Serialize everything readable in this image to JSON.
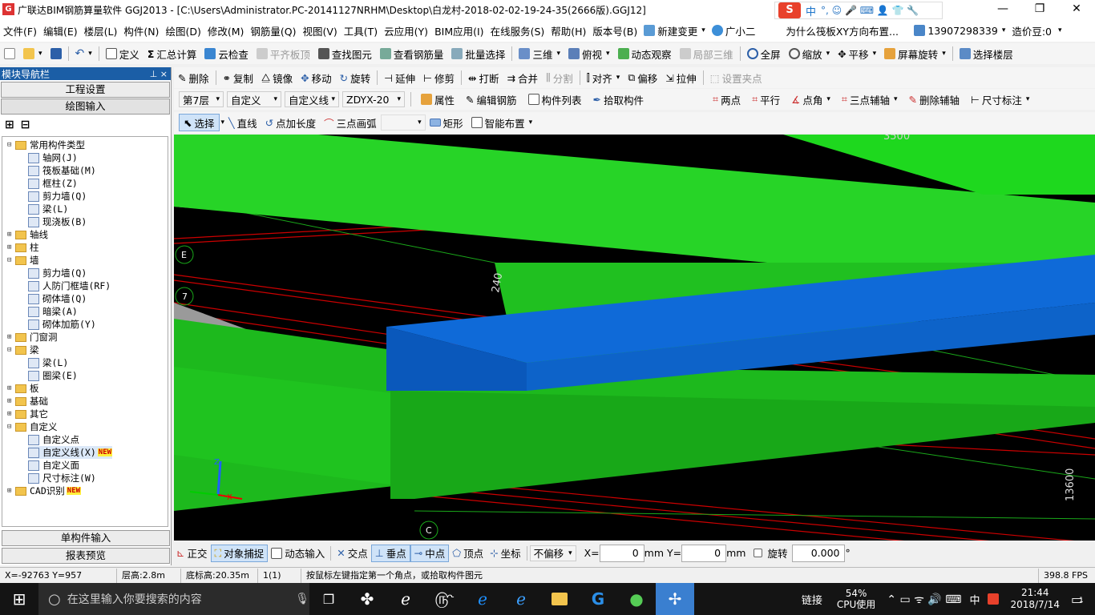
{
  "title": {
    "text": "广联达BIM钢筋算量软件 GGJ2013 - [C:\\Users\\Administrator.PC-20141127NRHM\\Desktop\\白龙村-2018-02-02-19-24-35(2666版).GGJ12]",
    "minimize": "—",
    "restore": "❐",
    "close": "✕"
  },
  "ime": {
    "logo": "S",
    "lang": "中",
    "glyphs": "°, ☺ 🎤 ⌨ 👤 👕 🔧"
  },
  "menu": [
    "文件(F)",
    "编辑(E)",
    "楼层(L)",
    "构件(N)",
    "绘图(D)",
    "修改(M)",
    "钢筋量(Q)",
    "视图(V)",
    "工具(T)",
    "云应用(Y)",
    "BIM应用(I)",
    "在线服务(S)",
    "帮助(H)",
    "版本号(B)"
  ],
  "menu_right": {
    "change": "新建变更",
    "assistant": "广小二",
    "question": "为什么筏板XY方向布置...",
    "phone": "13907298339",
    "beans": "造价豆:0"
  },
  "tb1": [
    "定义",
    "汇总计算",
    "云检查",
    "平齐板顶",
    "查找图元",
    "查看钢筋量",
    "批量选择",
    "三维",
    "俯视",
    "动态观察",
    "局部三维",
    "全屏",
    "缩放",
    "平移",
    "屏幕旋转",
    "选择楼层"
  ],
  "tb2": [
    "删除",
    "复制",
    "镜像",
    "移动",
    "旋转",
    "延伸",
    "修剪",
    "打断",
    "合并",
    "分割",
    "对齐",
    "偏移",
    "拉伸",
    "设置夹点"
  ],
  "tb3": {
    "floor": "第7层",
    "type": "自定义",
    "sub": "自定义线",
    "name": "ZDYX-20",
    "attr": "属性",
    "edit": "编辑钢筋",
    "list": "构件列表",
    "pick": "拾取构件",
    "twopt": "两点",
    "parallel": "平行",
    "ptangle": "点角",
    "three": "三点辅轴",
    "delaux": "删除辅轴",
    "dim": "尺寸标注"
  },
  "tb4": {
    "select": "选择",
    "line": "直线",
    "ptlen": "点加长度",
    "arc": "三点画弧",
    "rect": "矩形",
    "smart": "智能布置"
  },
  "nav": {
    "header": "模块导航栏",
    "pin": "⊥ ×",
    "proj": "工程设置",
    "draw": "绘图输入",
    "single": "单构件输入",
    "report": "报表预览",
    "new": "NEW"
  },
  "tree": [
    {
      "t": "常用构件类型",
      "lv": 0,
      "f": 1,
      "ex": "⊟"
    },
    {
      "t": "轴网(J)",
      "lv": 1
    },
    {
      "t": "筏板基础(M)",
      "lv": 1
    },
    {
      "t": "框柱(Z)",
      "lv": 1
    },
    {
      "t": "剪力墙(Q)",
      "lv": 1
    },
    {
      "t": "梁(L)",
      "lv": 1
    },
    {
      "t": "现浇板(B)",
      "lv": 1
    },
    {
      "t": "轴线",
      "lv": 0,
      "f": 1,
      "ex": "⊞"
    },
    {
      "t": "柱",
      "lv": 0,
      "f": 1,
      "ex": "⊞"
    },
    {
      "t": "墙",
      "lv": 0,
      "f": 1,
      "ex": "⊟"
    },
    {
      "t": "剪力墙(Q)",
      "lv": 1
    },
    {
      "t": "人防门框墙(RF)",
      "lv": 1
    },
    {
      "t": "砌体墙(Q)",
      "lv": 1
    },
    {
      "t": "暗梁(A)",
      "lv": 1
    },
    {
      "t": "砌体加筋(Y)",
      "lv": 1
    },
    {
      "t": "门窗洞",
      "lv": 0,
      "f": 1,
      "ex": "⊞"
    },
    {
      "t": "梁",
      "lv": 0,
      "f": 1,
      "ex": "⊟"
    },
    {
      "t": "梁(L)",
      "lv": 1
    },
    {
      "t": "圈梁(E)",
      "lv": 1
    },
    {
      "t": "板",
      "lv": 0,
      "f": 1,
      "ex": "⊞"
    },
    {
      "t": "基础",
      "lv": 0,
      "f": 1,
      "ex": "⊞"
    },
    {
      "t": "其它",
      "lv": 0,
      "f": 1,
      "ex": "⊞"
    },
    {
      "t": "自定义",
      "lv": 0,
      "f": 1,
      "ex": "⊟"
    },
    {
      "t": "自定义点",
      "lv": 1
    },
    {
      "t": "自定义线(X)",
      "lv": 1,
      "n": 1,
      "sel": 1
    },
    {
      "t": "自定义面",
      "lv": 1
    },
    {
      "t": "尺寸标注(W)",
      "lv": 1
    },
    {
      "t": "CAD识别",
      "lv": 0,
      "f": 1,
      "ex": "⊞",
      "n": 1
    }
  ],
  "viewport": {
    "dim_top": "3500",
    "dim_mid": "240",
    "dim_right": "13600",
    "axis_e": "E",
    "axis_7": "7",
    "axis_c": "C",
    "gizmo_z": "Z",
    "gizmo_x": "X"
  },
  "snap": {
    "ortho": "正交",
    "osnap": "对象捕捉",
    "dyn": "动态输入",
    "inter": "交点",
    "perp": "垂点",
    "mid": "中点",
    "vertex": "顶点",
    "coord": "坐标",
    "nooff": "不偏移",
    "xl": "X=",
    "xv": "0",
    "mm": "mm",
    "yl": "Y=",
    "yv": "0",
    "rot": "旋转",
    "rv": "0.000",
    "deg": "°"
  },
  "status": {
    "coords": "X=-92763 Y=957",
    "height": "层高:2.8m",
    "base": "底标高:20.35m",
    "count": "1(1)",
    "hint": "按鼠标左键指定第一个角点，或拾取构件图元",
    "fps": "398.8 FPS"
  },
  "taskbar": {
    "search": "在这里输入你要搜索的内容",
    "link": "链接",
    "cpu": "54%",
    "cpu_label": "CPU使用",
    "lang": "中",
    "time": "21:44",
    "date": "2018/7/14",
    "notif": "1"
  }
}
